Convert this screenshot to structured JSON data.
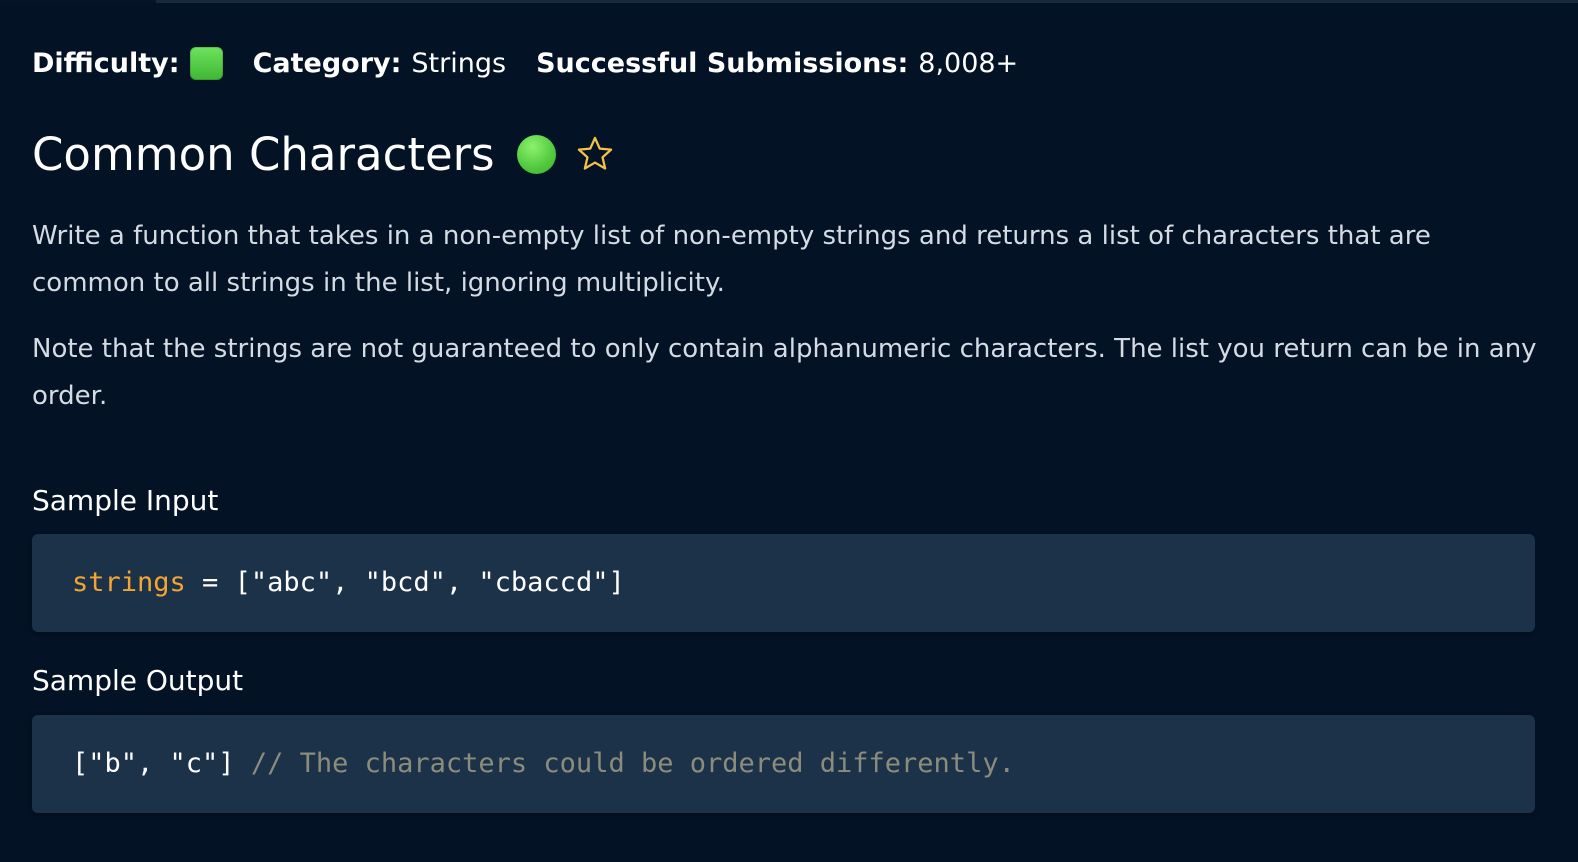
{
  "meta": {
    "difficulty_label": "Difficulty:",
    "category_label": "Category:",
    "category_value": "Strings",
    "submissions_label": "Successful Submissions:",
    "submissions_value": "8,008+",
    "difficulty_color": "#4fc43c"
  },
  "problem": {
    "title": "Common Characters",
    "star_icon": "star-outline-icon",
    "star_color": "#f4c24a",
    "paragraphs": [
      "Write a function that takes in a non-empty list of non-empty strings and returns a list of characters that are common to all strings in the list, ignoring multiplicity.",
      "Note that the strings are not guaranteed to only contain alphanumeric characters. The list you return can be in any order."
    ]
  },
  "sample_input": {
    "label": "Sample Input",
    "variable": "strings",
    "assignment": " = ",
    "value": "[\"abc\", \"bcd\", \"cbaccd\"]"
  },
  "sample_output": {
    "label": "Sample Output",
    "value": "[\"b\", \"c\"]",
    "separator": " ",
    "comment": "// The characters could be ordered differently."
  }
}
